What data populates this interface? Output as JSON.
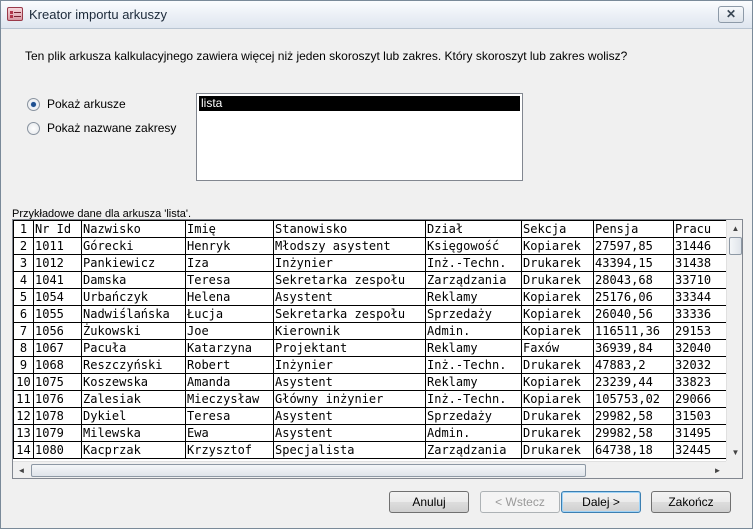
{
  "window": {
    "title": "Kreator importu arkuszy",
    "close_glyph": "✕"
  },
  "question": "Ten plik arkusza kalkulacyjnego zawiera więcej niż jeden skoroszyt lub zakres. Który skoroszyt lub zakres wolisz?",
  "options": [
    {
      "label": "Pokaż arkusze",
      "checked": true
    },
    {
      "label": "Pokaż nazwane zakresy",
      "checked": false
    }
  ],
  "sheets": [
    "lista"
  ],
  "sample_caption": "Przykładowe dane dla arkusza 'lista'.",
  "table": {
    "columns": [
      "Nr Id",
      "Nazwisko",
      "Imię",
      "Stanowisko",
      "Dział",
      "Sekcja",
      "Pensja",
      "Pracu"
    ],
    "rows": [
      [
        "1011",
        "Górecki",
        "Henryk",
        "Młodszy asystent",
        "Księgowość",
        "Kopiarek",
        "27597,85",
        "31446"
      ],
      [
        "1012",
        "Pankiewicz",
        "Iza",
        "Inżynier",
        "Inż.-Techn.",
        "Drukarek",
        "43394,15",
        "31438"
      ],
      [
        "1041",
        "Damska",
        "Teresa",
        "Sekretarka zespołu",
        "Zarządzania",
        "Drukarek",
        "28043,68",
        "33710"
      ],
      [
        "1054",
        "Urbańczyk",
        "Helena",
        "Asystent",
        "Reklamy",
        "Kopiarek",
        "25176,06",
        "33344"
      ],
      [
        "1055",
        "Nadwiślańska",
        "Łucja",
        "Sekretarka zespołu",
        "Sprzedaży",
        "Kopiarek",
        "26040,56",
        "33336"
      ],
      [
        "1056",
        "Żukowski",
        "Joe",
        "Kierownik",
        "Admin.",
        "Kopiarek",
        "116511,36",
        "29153"
      ],
      [
        "1067",
        "Pacuła",
        "Katarzyna",
        "Projektant",
        "Reklamy",
        "Faxów",
        "36939,84",
        "32040"
      ],
      [
        "1068",
        "Reszczyński",
        "Robert",
        "Inżynier",
        "Inż.-Techn.",
        "Drukarek",
        "47883,2",
        "32032"
      ],
      [
        "1075",
        "Koszewska",
        "Amanda",
        "Asystent",
        "Reklamy",
        "Kopiarek",
        "23239,44",
        "33823"
      ],
      [
        "1076",
        "Zalesiak",
        "Mieczysław",
        "Główny inżynier",
        "Inż.-Techn.",
        "Kopiarek",
        "105753,02",
        "29066"
      ],
      [
        "1078",
        "Dykiel",
        "Teresa",
        "Asystent",
        "Sprzedaży",
        "Drukarek",
        "29982,58",
        "31503"
      ],
      [
        "1079",
        "Milewska",
        "Ewa",
        "Asystent",
        "Admin.",
        "Drukarek",
        "29982,58",
        "31495"
      ],
      [
        "1080",
        "Kacprzak",
        "Krzysztof",
        "Specjalista",
        "Zarządzania",
        "Drukarek",
        "64738,18",
        "32445"
      ]
    ]
  },
  "buttons": {
    "cancel": "Anuluj",
    "back": "< Wstecz",
    "next": "Dalej >",
    "finish": "Zakończ"
  },
  "scroll_glyphs": {
    "up": "▲",
    "down": "▼",
    "left": "◄",
    "right": "►"
  }
}
